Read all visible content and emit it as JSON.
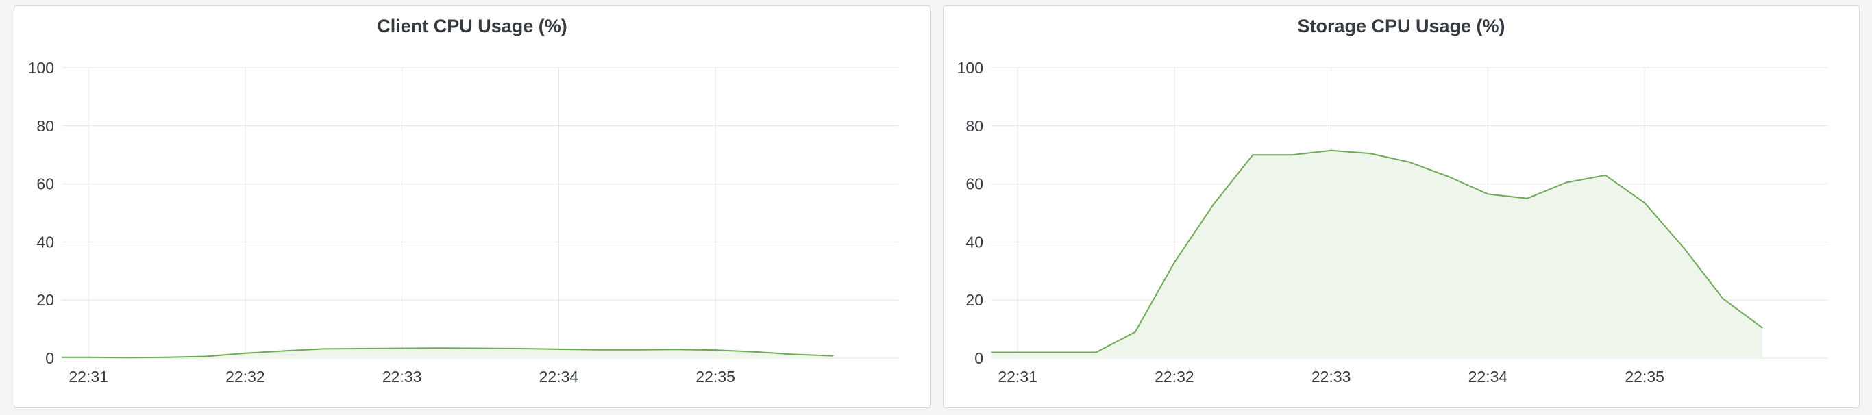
{
  "colors": {
    "grid": "#e3e3e3",
    "line": "#6ea957",
    "fill": "#eef5eb"
  },
  "chart_data": [
    {
      "type": "area",
      "title": "Client CPU Usage (%)",
      "xlabel": "",
      "ylabel": "",
      "ylim": [
        0,
        100
      ],
      "yticks": [
        "0",
        "20",
        "40",
        "60",
        "80",
        "100"
      ],
      "xticks": [
        "22:31",
        "22:32",
        "22:33",
        "22:34",
        "22:35"
      ],
      "xlim": [
        "22:30:50",
        "22:36:10"
      ],
      "grid": true,
      "legend": "none",
      "series": [
        {
          "x": [
            "22:30:50",
            "22:31:00",
            "22:31:15",
            "22:31:30",
            "22:31:45",
            "22:32:00",
            "22:32:15",
            "22:32:30",
            "22:32:45",
            "22:33:00",
            "22:33:15",
            "22:33:30",
            "22:33:45",
            "22:34:00",
            "22:34:15",
            "22:34:30",
            "22:34:45",
            "22:35:00",
            "22:35:15",
            "22:35:30",
            "22:35:45"
          ],
          "values": [
            0.3,
            0.3,
            0.2,
            0.3,
            0.6,
            1.7,
            2.5,
            3.2,
            3.3,
            3.4,
            3.5,
            3.4,
            3.3,
            3.1,
            2.9,
            2.9,
            3.0,
            2.8,
            2.2,
            1.3,
            0.8
          ]
        }
      ]
    },
    {
      "type": "area",
      "title": "Storage CPU Usage (%)",
      "xlabel": "",
      "ylabel": "",
      "ylim": [
        0,
        100
      ],
      "yticks": [
        "0",
        "20",
        "40",
        "60",
        "80",
        "100"
      ],
      "xticks": [
        "22:31",
        "22:32",
        "22:33",
        "22:34",
        "22:35"
      ],
      "xlim": [
        "22:30:50",
        "22:36:10"
      ],
      "grid": true,
      "legend": "none",
      "series": [
        {
          "x": [
            "22:30:50",
            "22:31:00",
            "22:31:15",
            "22:31:30",
            "22:31:45",
            "22:32:00",
            "22:32:15",
            "22:32:30",
            "22:32:45",
            "22:33:00",
            "22:33:15",
            "22:33:30",
            "22:33:45",
            "22:34:00",
            "22:34:15",
            "22:34:30",
            "22:34:45",
            "22:35:00",
            "22:35:15",
            "22:35:30",
            "22:35:45"
          ],
          "values": [
            2.0,
            2.0,
            2.0,
            2.0,
            9.0,
            33.0,
            53.0,
            70.0,
            70.0,
            71.5,
            70.5,
            67.5,
            62.5,
            56.5,
            55.0,
            60.5,
            63.0,
            53.5,
            38.0,
            20.5,
            10.5
          ]
        }
      ]
    }
  ]
}
